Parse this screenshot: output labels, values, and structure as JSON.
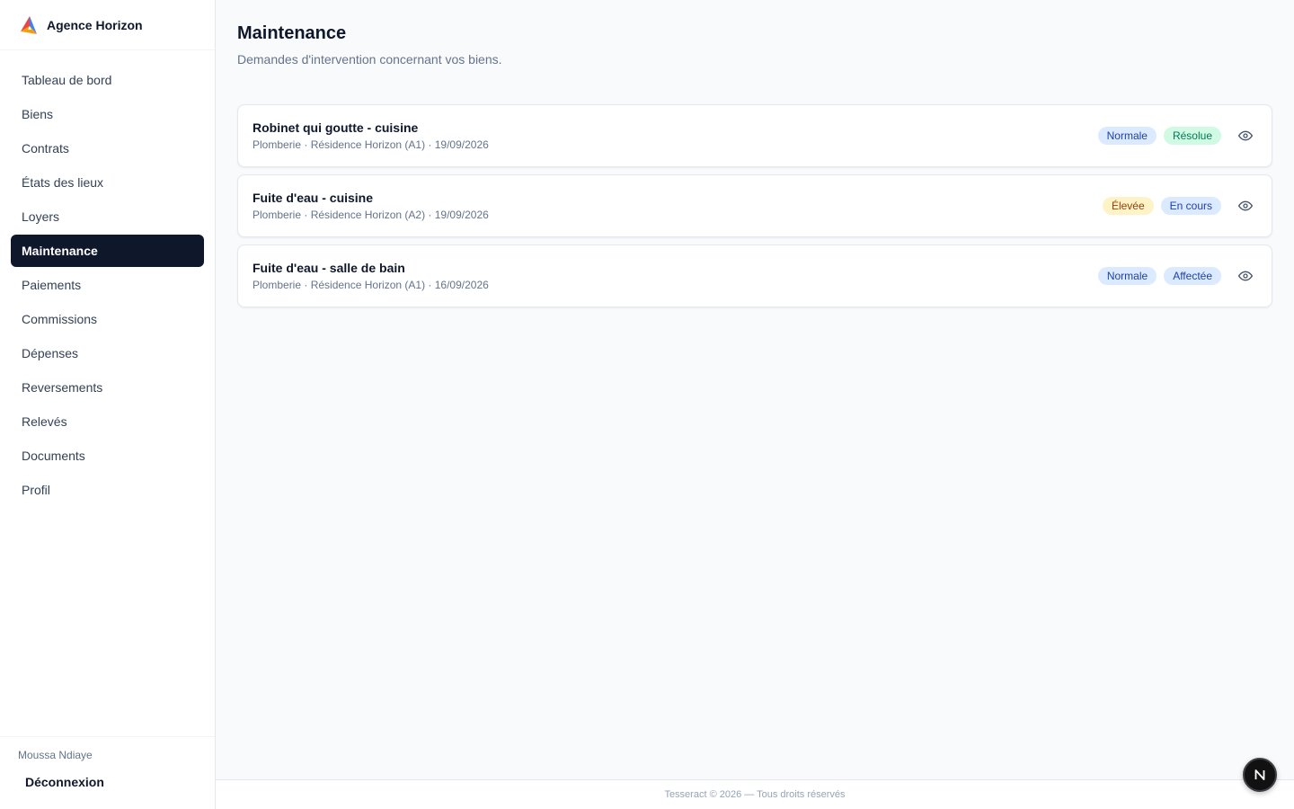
{
  "brand": {
    "name": "Agence Horizon"
  },
  "sidebar": {
    "items": [
      {
        "label": "Tableau de bord",
        "active": false
      },
      {
        "label": "Biens",
        "active": false
      },
      {
        "label": "Contrats",
        "active": false
      },
      {
        "label": "États des lieux",
        "active": false
      },
      {
        "label": "Loyers",
        "active": false
      },
      {
        "label": "Maintenance",
        "active": true
      },
      {
        "label": "Paiements",
        "active": false
      },
      {
        "label": "Commissions",
        "active": false
      },
      {
        "label": "Dépenses",
        "active": false
      },
      {
        "label": "Reversements",
        "active": false
      },
      {
        "label": "Relevés",
        "active": false
      },
      {
        "label": "Documents",
        "active": false
      },
      {
        "label": "Profil",
        "active": false
      }
    ],
    "user_name": "Moussa Ndiaye",
    "logout_label": "Déconnexion"
  },
  "page": {
    "title": "Maintenance",
    "subtitle": "Demandes d'intervention concernant vos biens."
  },
  "requests": [
    {
      "title": "Robinet qui goutte - cuisine",
      "meta": "Plomberie · Résidence Horizon (A1) · 19/09/2026",
      "priority": "Normale",
      "status": "Résolue"
    },
    {
      "title": "Fuite d'eau - cuisine",
      "meta": "Plomberie · Résidence Horizon (A2) · 19/09/2026",
      "priority": "Élevée",
      "status": "En cours"
    },
    {
      "title": "Fuite d'eau - salle de bain",
      "meta": "Plomberie · Résidence Horizon (A1) · 16/09/2026",
      "priority": "Normale",
      "status": "Affectée"
    }
  ],
  "footer": {
    "text": "Tesseract © 2026 — Tous droits réservés"
  },
  "fab": {
    "label": "N"
  },
  "colors": {
    "active_nav_bg": "#0f172a",
    "badge_blue_bg": "#dbeafe",
    "badge_green_bg": "#d1fae5",
    "badge_amber_bg": "#fef3c7"
  }
}
